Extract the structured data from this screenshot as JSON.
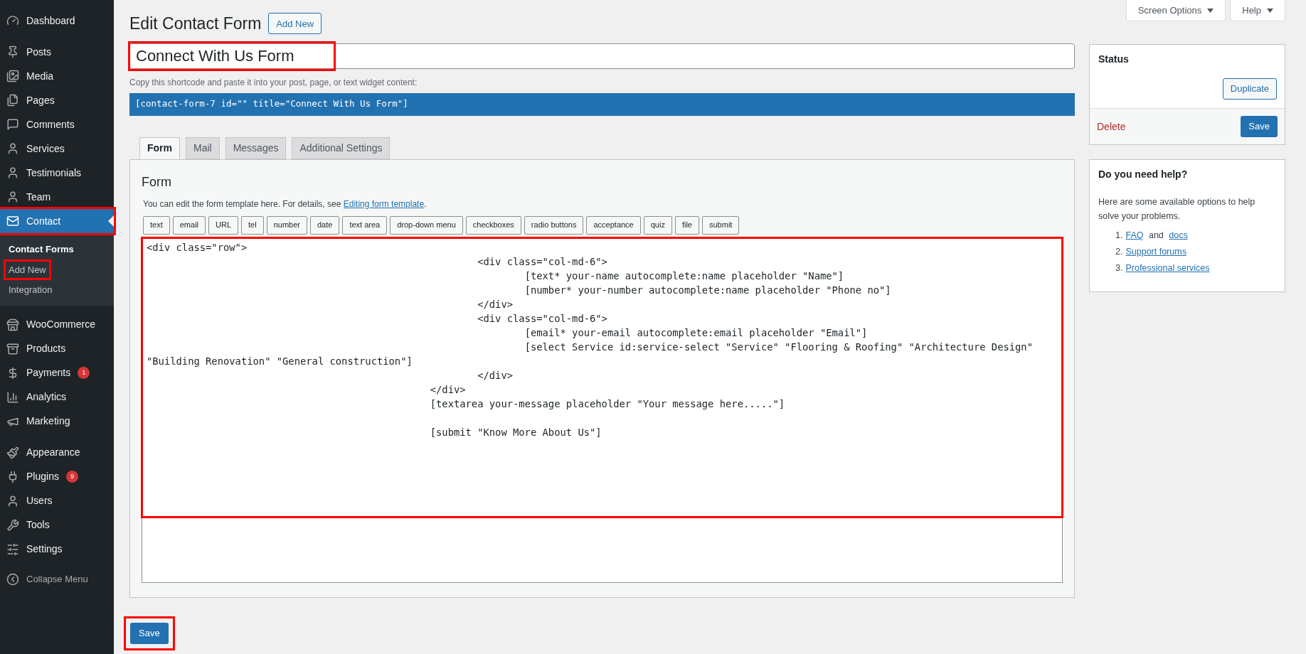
{
  "sidebar": {
    "groups": [
      [
        {
          "label": "Dashboard",
          "selected": false,
          "highlighted": false
        }
      ],
      [
        {
          "label": "Posts",
          "selected": false,
          "highlighted": false
        },
        {
          "label": "Media",
          "selected": false,
          "highlighted": false
        },
        {
          "label": "Pages",
          "selected": false,
          "highlighted": false
        },
        {
          "label": "Comments",
          "selected": false,
          "highlighted": false
        },
        {
          "label": "Services",
          "selected": false,
          "highlighted": false
        },
        {
          "label": "Testimonials",
          "selected": false,
          "highlighted": false
        },
        {
          "label": "Team",
          "selected": false,
          "highlighted": false
        },
        {
          "label": "Contact",
          "selected": true,
          "highlighted": true,
          "children": [
            {
              "label": "Contact Forms",
              "selected": true,
              "highlighted": false
            },
            {
              "label": "Add New",
              "selected": false,
              "highlighted": true
            },
            {
              "label": "Integration",
              "selected": false,
              "highlighted": false
            }
          ]
        }
      ],
      [
        {
          "label": "WooCommerce",
          "selected": false,
          "highlighted": false
        },
        {
          "label": "Products",
          "selected": false,
          "highlighted": false
        },
        {
          "label": "Payments",
          "selected": false,
          "highlighted": false,
          "badge": "1"
        },
        {
          "label": "Analytics",
          "selected": false,
          "highlighted": false
        },
        {
          "label": "Marketing",
          "selected": false,
          "highlighted": false
        }
      ],
      [
        {
          "label": "Appearance",
          "selected": false,
          "highlighted": false
        },
        {
          "label": "Plugins",
          "selected": false,
          "highlighted": false,
          "badge": "9"
        },
        {
          "label": "Users",
          "selected": false,
          "highlighted": false
        },
        {
          "label": "Tools",
          "selected": false,
          "highlighted": false
        },
        {
          "label": "Settings",
          "selected": false,
          "highlighted": false
        }
      ]
    ],
    "collapse": "Collapse Menu"
  },
  "top_buttons": [
    "Screen Options",
    "Help"
  ],
  "header": {
    "title": "Edit Contact Form",
    "add_new": "Add New"
  },
  "title_field": {
    "value": "Connect With Us Form",
    "highlighted": true
  },
  "shortcode": {
    "hint": "Copy this shortcode and paste it into your post, page, or text widget content:",
    "code": "[contact-form-7 id=\"\" title=\"Connect With Us Form\"]"
  },
  "tabs": [
    {
      "label": "Form",
      "selected": true
    },
    {
      "label": "Mail",
      "selected": false
    },
    {
      "label": "Messages",
      "selected": false
    },
    {
      "label": "Additional Settings",
      "selected": false
    }
  ],
  "form_panel": {
    "heading": "Form",
    "description": "You can edit the form template here. For details, see ",
    "link": "Editing form template",
    "after_link": ".",
    "tag_buttons": [
      "text",
      "email",
      "URL",
      "tel",
      "number",
      "date",
      "text area",
      "drop-down menu",
      "checkboxes",
      "radio buttons",
      "acceptance",
      "quiz",
      "file",
      "submit"
    ],
    "template": "<div class=\"row\">\n\t\t\t\t\t\t\t<div class=\"col-md-6\">\n\t\t\t\t\t\t\t\t[text* your-name autocomplete:name placeholder \"Name\"]\n\t\t\t\t\t\t\t\t[number* your-number autocomplete:name placeholder \"Phone no\"]\n\t\t\t\t\t\t\t</div>\n\t\t\t\t\t\t\t<div class=\"col-md-6\">\n\t\t\t\t\t\t\t\t[email* your-email autocomplete:email placeholder \"Email\"]\n\t\t\t\t\t\t\t\t[select Service id:service-select \"Service\" \"Flooring & Roofing\" \"Architecture Design\" \"Building Renovation\" \"General construction\"]\n\t\t\t\t\t\t\t</div>\n\t\t\t\t\t\t</div>\n\t\t\t\t\t\t[textarea your-message placeholder \"Your message here.....\"]\n\n\t\t\t\t\t\t[submit \"Know More About Us\"]",
    "template_highlighted": true
  },
  "save": {
    "label": "Save",
    "highlighted": true
  },
  "status_box": {
    "title": "Status",
    "duplicate": "Duplicate",
    "delete": "Delete",
    "save": "Save"
  },
  "help_box": {
    "title": "Do you need help?",
    "text": "Here are some available options to help solve your problems.",
    "items": [
      {
        "number": "1.",
        "links": [
          "FAQ",
          "docs"
        ],
        "joiner": " and "
      },
      {
        "number": "2.",
        "links": [
          "Support forums"
        ]
      },
      {
        "number": "3.",
        "links": [
          "Professional services"
        ]
      }
    ]
  }
}
